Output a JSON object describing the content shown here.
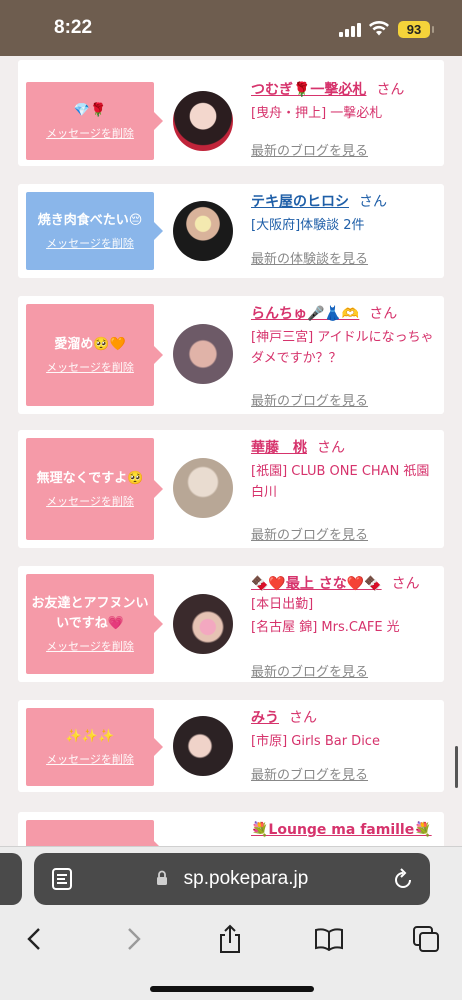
{
  "status": {
    "time": "8:22",
    "battery": "93"
  },
  "browser": {
    "url": "sp.pokepara.jp"
  },
  "cards": [
    {
      "message": "💎🌹",
      "delete": "メッセージを削除",
      "name": "つむぎ🌹一撃必札",
      "honorific": "さん",
      "shop": "[曳舟・押上] 一撃必札",
      "link": "最新のブログを見る"
    },
    {
      "message": "焼き肉食べたい😔",
      "delete": "メッセージを削除",
      "name": "テキ屋のヒロシ",
      "honorific": "さん",
      "shop": "[大阪府]体験談 2件",
      "link": "最新の体験談を見る"
    },
    {
      "message": "愛溜め🥺🧡",
      "delete": "メッセージを削除",
      "name": "らんちゅ🎤👗🫶",
      "honorific": "さん",
      "shop": "[神戸三宮] アイドルになっちゃダメですか？？",
      "link": "最新のブログを見る"
    },
    {
      "message": "無理なくですよ🥺",
      "delete": "メッセージを削除",
      "name": "華藤　桃",
      "honorific": "さん",
      "shop": "[祇園] CLUB ONE CHAN 祇園白川",
      "link": "最新のブログを見る"
    },
    {
      "message": "お友達とアフヌンいいですね💗",
      "delete": "メッセージを削除",
      "name": "🍫❤️最上 さな❤️🍫",
      "honorific": "さん",
      "shop_line1": "[本日出勤]",
      "shop": "[名古屋 錦] Mrs.CAFE 光",
      "link": "最新のブログを見る"
    },
    {
      "message": "✨✨✨",
      "delete": "メッセージを削除",
      "name": "みう",
      "honorific": "さん",
      "shop": "[市原] Girls Bar Dice",
      "link": "最新のブログを見る"
    },
    {
      "name": "💐Lounge ma famille💐"
    }
  ]
}
